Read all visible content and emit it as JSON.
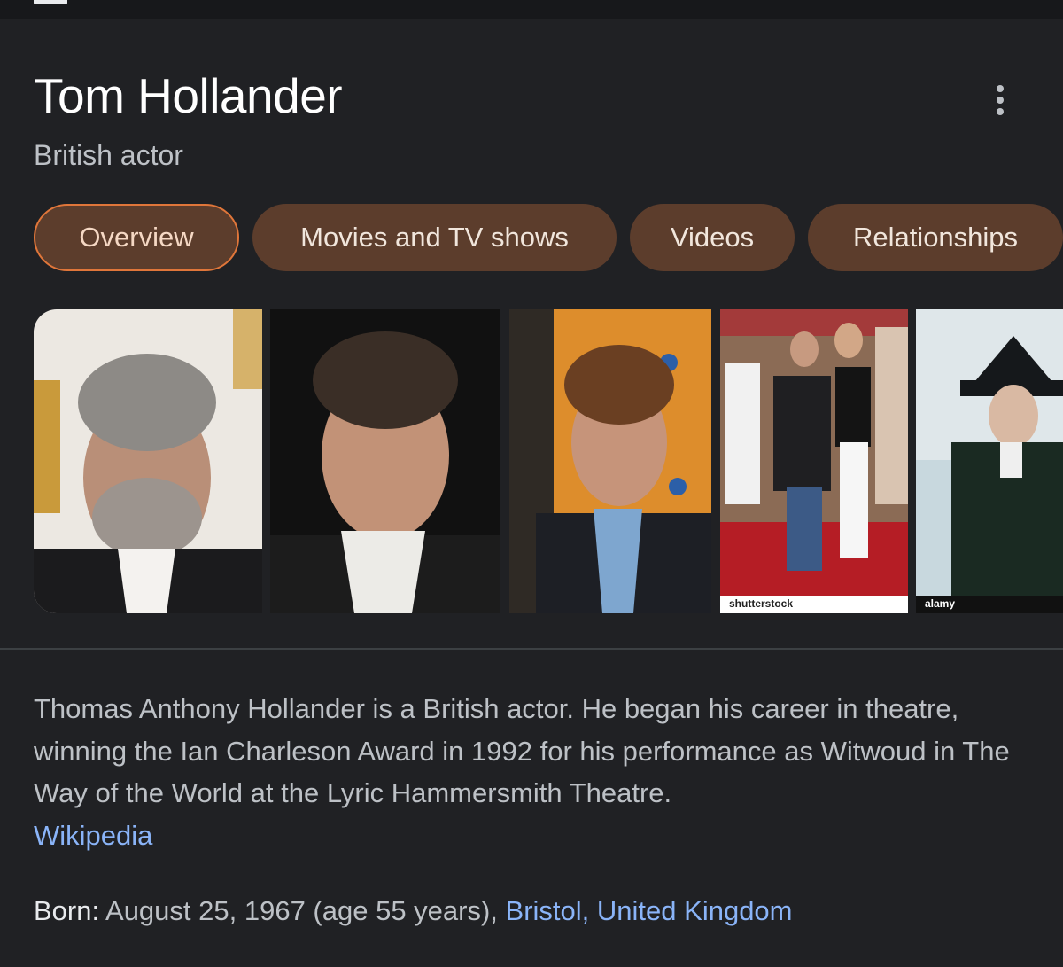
{
  "header": {
    "title": "Tom Hollander",
    "subtitle": "British actor",
    "more_icon": "more-vert-icon"
  },
  "tabs": [
    {
      "label": "Overview",
      "active": true
    },
    {
      "label": "Movies and TV shows",
      "active": false
    },
    {
      "label": "Videos",
      "active": false
    },
    {
      "label": "Relationships",
      "active": false
    }
  ],
  "images": [
    {
      "alt": "portrait-grey-beard"
    },
    {
      "alt": "portrait-dark-background"
    },
    {
      "alt": "portrait-event-background"
    },
    {
      "alt": "red-carpet-photo",
      "watermark": "shutterstock"
    },
    {
      "alt": "costume-tricorn-hat",
      "watermark": "alamy"
    }
  ],
  "description": {
    "text": "Thomas Anthony Hollander is a British actor. He began his career in theatre, winning the Ian Charleson Award in 1992 for his performance as Witwoud in The Way of the World at the Lyric Hammersmith Theatre.",
    "source_link": "Wikipedia"
  },
  "born": {
    "label": "Born:",
    "date": "August 25, 1967 (age 55 years),",
    "place_city": "Bristol,",
    "place_country": "United Kingdom"
  },
  "colors": {
    "background": "#202124",
    "chip": "#5c3d2c",
    "chip_active_border": "#e0763a",
    "link": "#8ab4f8"
  }
}
